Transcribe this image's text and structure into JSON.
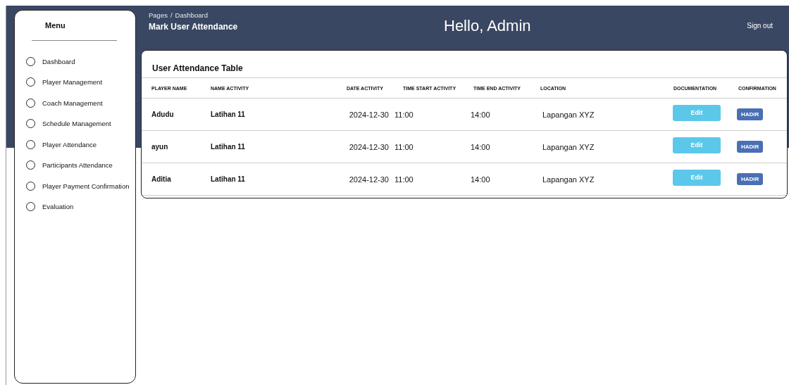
{
  "sidebar": {
    "title": "Menu",
    "items": [
      {
        "label": "Dashboard",
        "selected": false
      },
      {
        "label": "Player Management",
        "selected": false
      },
      {
        "label": "Coach Management",
        "selected": false
      },
      {
        "label": "Schedule Management",
        "selected": false
      },
      {
        "label": "Player Attendance",
        "selected": false
      },
      {
        "label": "Participants Attendance",
        "selected": false
      },
      {
        "label": "Player Payment Confirmation",
        "selected": false
      },
      {
        "label": "Evaluation",
        "selected": false
      }
    ]
  },
  "header": {
    "breadcrumb": [
      "Pages",
      "/",
      "Dashboard"
    ],
    "page_title": "Mark User Attendance",
    "greeting": "Hello, Admin",
    "sign_out": "Sign out"
  },
  "table": {
    "title": "User Attendance Table",
    "columns": [
      "PLAYER NAME",
      "NAME ACTIVITY",
      "DATE ACTIVITY",
      "TIME START ACTIVITY",
      "TIME END ACTIVITY",
      "LOCATION",
      "DOCUMENTATION",
      "CONFIRMATION"
    ],
    "rows": [
      {
        "player": "Adudu",
        "activity": "Latihan 11",
        "date": "2024-12-30",
        "start": "11:00",
        "end": "14:00",
        "location": "Lapangan XYZ",
        "documentation": "Edit",
        "confirmation": "HADIR"
      },
      {
        "player": "ayun",
        "activity": "Latihan 11",
        "date": "2024-12-30",
        "start": "11:00",
        "end": "14:00",
        "location": "Lapangan XYZ",
        "documentation": "Edit",
        "confirmation": "HADIR"
      },
      {
        "player": "Aditia",
        "activity": "Latihan 11",
        "date": "2024-12-30",
        "start": "11:00",
        "end": "14:00",
        "location": "Lapangan XYZ",
        "documentation": "Edit",
        "confirmation": "HADIR"
      }
    ]
  }
}
